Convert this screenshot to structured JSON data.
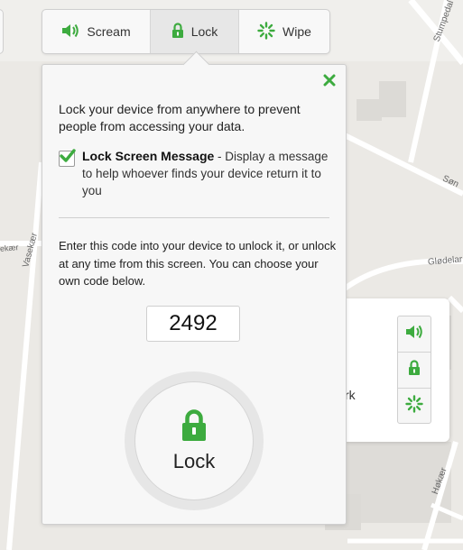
{
  "colors": {
    "accent": "#3dab3f",
    "panel": "#f7f7f7",
    "map": "#ebe9e5"
  },
  "map": {
    "streets": [
      {
        "name": "Stumpedal"
      },
      {
        "name": "Søn"
      },
      {
        "name": "Glødelar"
      },
      {
        "name": "Vasekær"
      },
      {
        "name": "ekær"
      },
      {
        "name": "Høkær"
      }
    ]
  },
  "toolbar": {
    "scream": {
      "label": "Scream",
      "icon": "speaker-icon"
    },
    "lock": {
      "label": "Lock",
      "icon": "padlock-icon"
    },
    "wipe": {
      "label": "Wipe",
      "icon": "spinner-icon"
    }
  },
  "lock_panel": {
    "intro": "Lock your device from anywhere to prevent people from accessing your data.",
    "option": {
      "checked": true,
      "title": "Lock Screen Message",
      "description": " - Display a message to help whoever finds your device return it to you"
    },
    "code_description": "Enter this code into your device to unlock it, or unlock at any time from this screen. You can choose your own code below.",
    "code_value": "2492",
    "lock_button_label": "Lock",
    "close_icon": "close-icon"
  },
  "device_card": {
    "partial_text": "rk",
    "actions": [
      "speaker-icon",
      "padlock-icon",
      "spinner-icon"
    ]
  }
}
